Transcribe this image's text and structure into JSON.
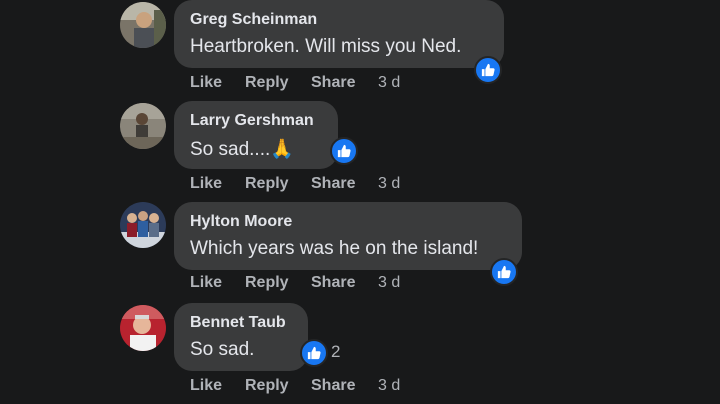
{
  "comments": [
    {
      "author": "Greg Scheinman",
      "text": "Heartbroken. Will miss you Ned.",
      "reaction": "like-icon",
      "reaction_count": "",
      "actions": {
        "like": "Like",
        "reply": "Reply",
        "share": "Share",
        "time": "3 d"
      }
    },
    {
      "author": "Larry Gershman",
      "text": "So sad....🙏",
      "reaction": "like-icon",
      "reaction_count": "",
      "actions": {
        "like": "Like",
        "reply": "Reply",
        "share": "Share",
        "time": "3 d"
      }
    },
    {
      "author": "Hylton Moore",
      "text": "Which years was he on the island!",
      "reaction": "like-icon",
      "reaction_count": "",
      "actions": {
        "like": "Like",
        "reply": "Reply",
        "share": "Share",
        "time": "3 d"
      }
    },
    {
      "author": "Bennet Taub",
      "text": "So sad.",
      "reaction": "like-icon",
      "reaction_count": "2",
      "actions": {
        "like": "Like",
        "reply": "Reply",
        "share": "Share",
        "time": "3 d"
      }
    }
  ],
  "colors": {
    "background": "#18191a",
    "bubble": "#3a3b3c",
    "text": "#e4e6eb",
    "secondary_text": "#b0b3b8",
    "like_blue": "#1877f2"
  }
}
